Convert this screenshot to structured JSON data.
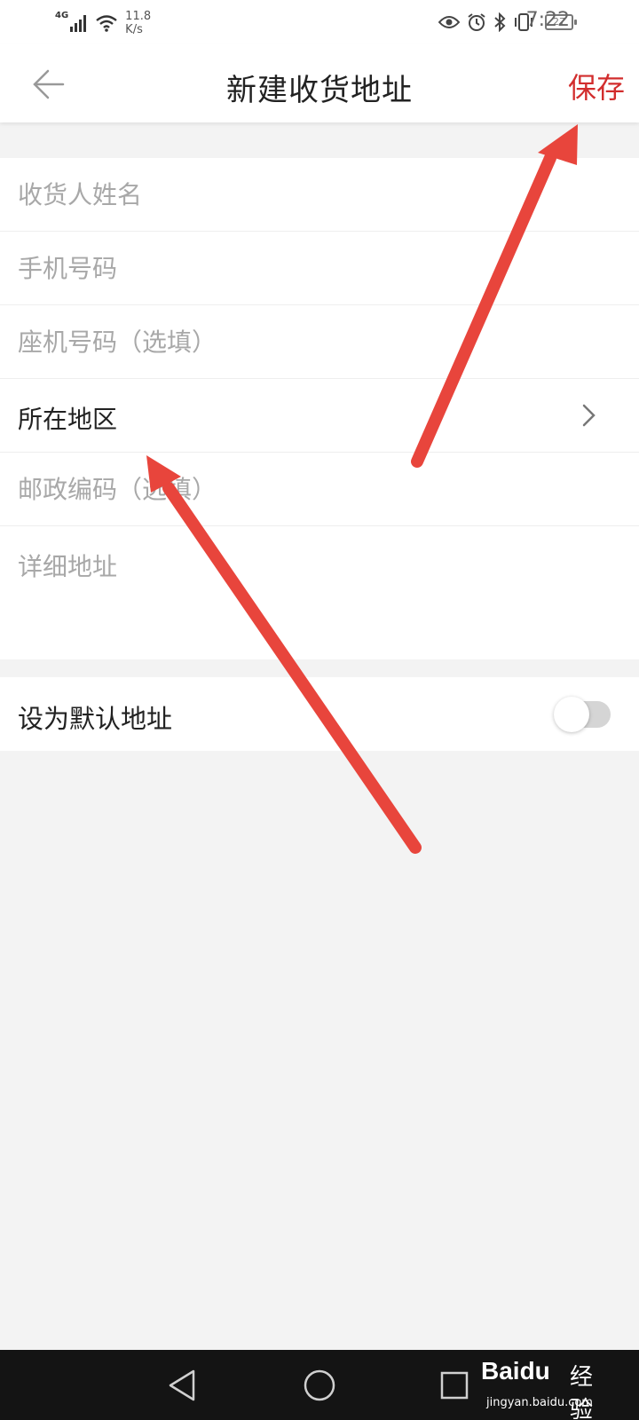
{
  "status_bar": {
    "network": "4G",
    "speed_value": "11.8",
    "speed_unit": "K/s",
    "battery": "27",
    "time": "7:22",
    "icons": [
      "signal-icon",
      "wifi-icon",
      "eye-icon",
      "alarm-icon",
      "bluetooth-icon",
      "vibrate-icon",
      "battery-icon"
    ]
  },
  "header": {
    "title": "新建收货地址",
    "save_label": "保存",
    "back_icon": "back-arrow-icon"
  },
  "form": {
    "name_placeholder": "收货人姓名",
    "phone_placeholder": "手机号码",
    "landline_placeholder": "座机号码（选填）",
    "region_label": "所在地区",
    "postcode_placeholder": "邮政编码（选填）",
    "address_placeholder": "详细地址"
  },
  "default_setting": {
    "label": "设为默认地址",
    "enabled": false
  },
  "navigation": {
    "icons": [
      "nav-back-icon",
      "nav-home-icon",
      "nav-recent-icon"
    ]
  },
  "watermark": {
    "logo": "Baidu",
    "suffix": "经验",
    "url": "jingyan.baidu.com"
  },
  "colors": {
    "accent": "#d22d2d",
    "annotation_arrow": "#e8453c",
    "background": "#f3f3f3",
    "placeholder": "#a8a8a8"
  }
}
